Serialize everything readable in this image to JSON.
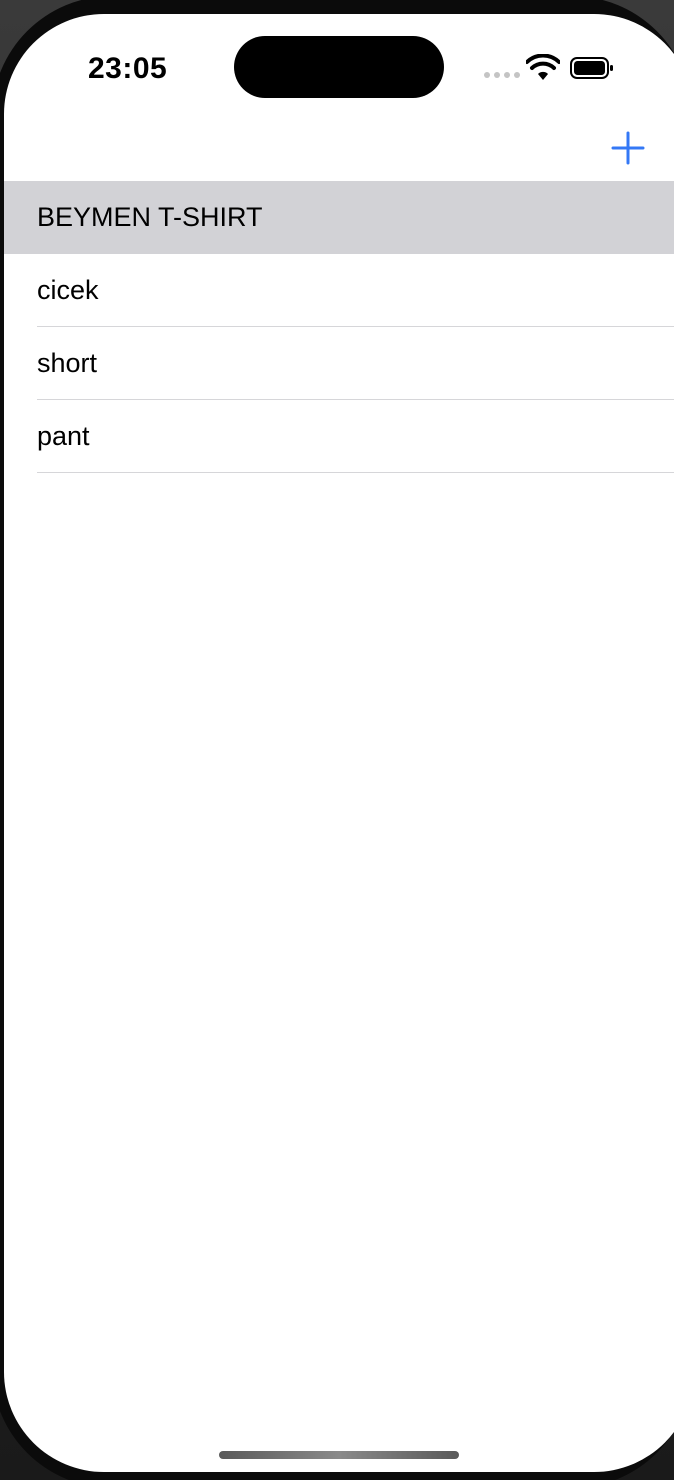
{
  "status_bar": {
    "time": "23:05",
    "signal_icon": "cellular-signal-icon",
    "wifi_icon": "wifi-icon",
    "battery_icon": "battery-icon"
  },
  "nav_bar": {
    "add_icon": "plus-icon",
    "accent_color": "#3478F6"
  },
  "list": {
    "selected_index": 0,
    "items": [
      {
        "label": "BEYMEN T-SHIRT"
      },
      {
        "label": "cicek"
      },
      {
        "label": "short"
      },
      {
        "label": "pant"
      }
    ]
  }
}
